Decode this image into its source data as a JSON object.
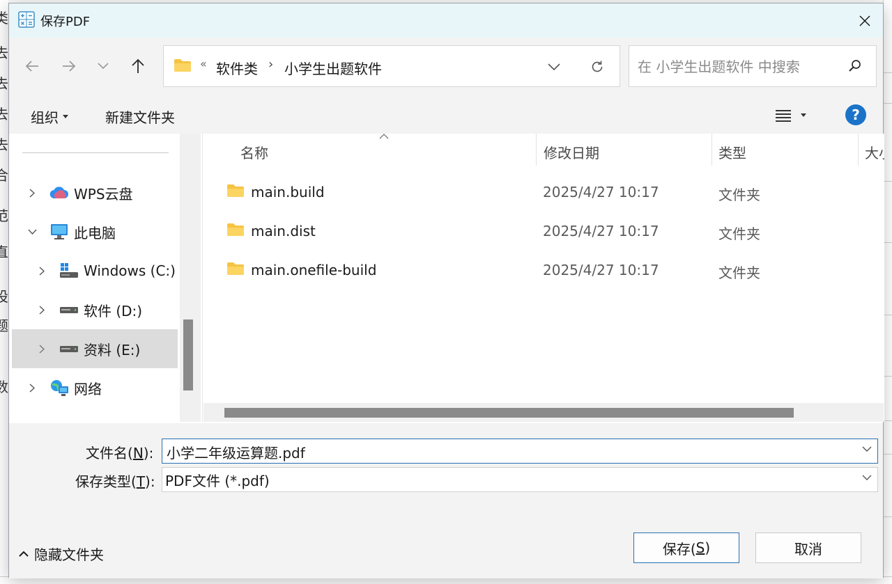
{
  "background": {
    "left_chars": [
      "类",
      "去",
      "去",
      "去",
      "去",
      "合",
      "范",
      "直",
      "设",
      "题",
      "数"
    ]
  },
  "dialog": {
    "title": "保存PDF",
    "icons": {
      "app": "calculator-icon",
      "close": "close-icon"
    }
  },
  "nav": {
    "back": "back-arrow-icon",
    "forward": "forward-arrow-icon",
    "recent": "chevron-down-icon",
    "up": "up-arrow-icon"
  },
  "address": {
    "overflow": "«",
    "crumbs": [
      "软件类",
      "小学生出题软件"
    ],
    "separator": "›"
  },
  "search": {
    "placeholder": "在 小学生出题软件 中搜索",
    "value": ""
  },
  "toolbar": {
    "organize": "组织",
    "new_folder": "新建文件夹",
    "help": "?"
  },
  "sidebar": {
    "items": [
      {
        "label": "WPS云盘",
        "icon": "cloud-icon",
        "expanded": false,
        "selected": false
      },
      {
        "label": "此电脑",
        "icon": "computer-icon",
        "expanded": true,
        "selected": false
      },
      {
        "label": "Windows (C:)",
        "icon": "windows-drive-icon",
        "expanded": false,
        "selected": false
      },
      {
        "label": "软件 (D:)",
        "icon": "drive-icon",
        "expanded": false,
        "selected": false
      },
      {
        "label": "资料 (E:)",
        "icon": "drive-icon",
        "expanded": false,
        "selected": true
      },
      {
        "label": "网络",
        "icon": "network-icon",
        "expanded": false,
        "selected": false
      }
    ]
  },
  "files": {
    "columns": [
      "名称",
      "修改日期",
      "类型",
      "大小"
    ],
    "rows": [
      {
        "name": "main.build",
        "date": "2025/4/27 10:17",
        "type": "文件夹"
      },
      {
        "name": "main.dist",
        "date": "2025/4/27 10:17",
        "type": "文件夹"
      },
      {
        "name": "main.onefile-build",
        "date": "2025/4/27 10:17",
        "type": "文件夹"
      }
    ]
  },
  "form": {
    "filename_label_prefix": "文件名(",
    "filename_label_key": "N",
    "filename_label_suffix": "):",
    "filename_value": "小学二年级运算题.pdf",
    "filetype_label_prefix": "保存类型(",
    "filetype_label_key": "T",
    "filetype_label_suffix": "):",
    "filetype_value": "PDF文件 (*.pdf)"
  },
  "footer": {
    "hide_folders": "隐藏文件夹",
    "save_prefix": "保存(",
    "save_key": "S",
    "save_suffix": ")",
    "cancel": "取消"
  },
  "colors": {
    "titlebar": "#e8f6f9",
    "panel": "#f3f3f3",
    "accent": "#2a6fb0",
    "help": "#1a73c8",
    "folder": "#f6c343"
  }
}
